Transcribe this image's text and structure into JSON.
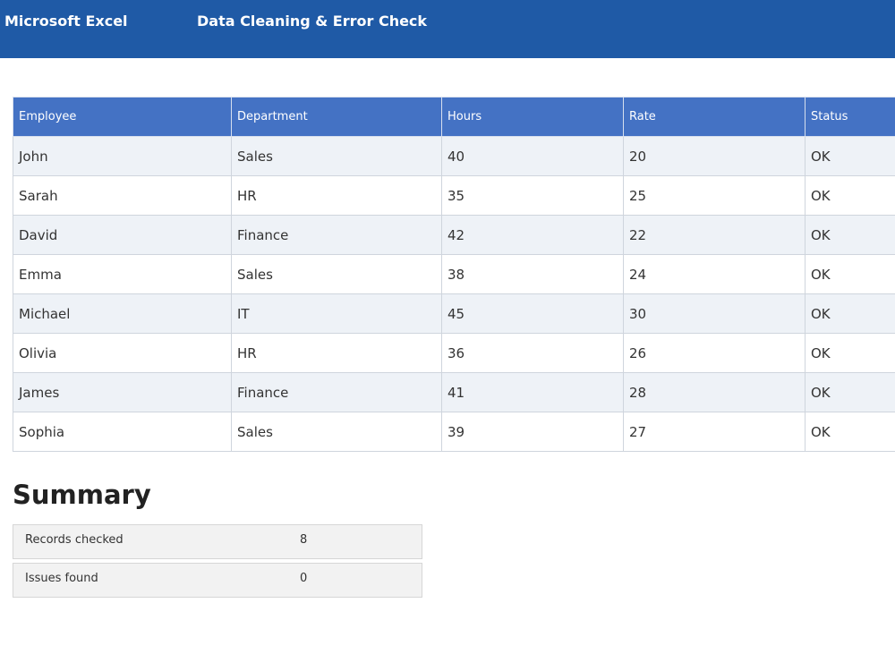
{
  "header": {
    "app_name": "Microsoft Excel",
    "doc_title": "Data Cleaning & Error Check",
    "background": "#1f5aa6"
  },
  "table": {
    "header_color": "#4472c4",
    "columns": [
      "Employee",
      "Department",
      "Hours",
      "Rate",
      "Status"
    ],
    "rows": [
      [
        "John",
        "Sales",
        "40",
        "20",
        "OK"
      ],
      [
        "Sarah",
        "HR",
        "35",
        "25",
        "OK"
      ],
      [
        "David",
        "Finance",
        "42",
        "22",
        "OK"
      ],
      [
        "Emma",
        "Sales",
        "38",
        "24",
        "OK"
      ],
      [
        "Michael",
        "IT",
        "45",
        "30",
        "OK"
      ],
      [
        "Olivia",
        "HR",
        "36",
        "26",
        "OK"
      ],
      [
        "James",
        "Finance",
        "41",
        "28",
        "OK"
      ],
      [
        "Sophia",
        "Sales",
        "39",
        "27",
        "OK"
      ]
    ]
  },
  "summary": {
    "title": "Summary",
    "items": [
      {
        "label": "Records checked",
        "value": "8"
      },
      {
        "label": "Issues found",
        "value": "0"
      }
    ]
  }
}
